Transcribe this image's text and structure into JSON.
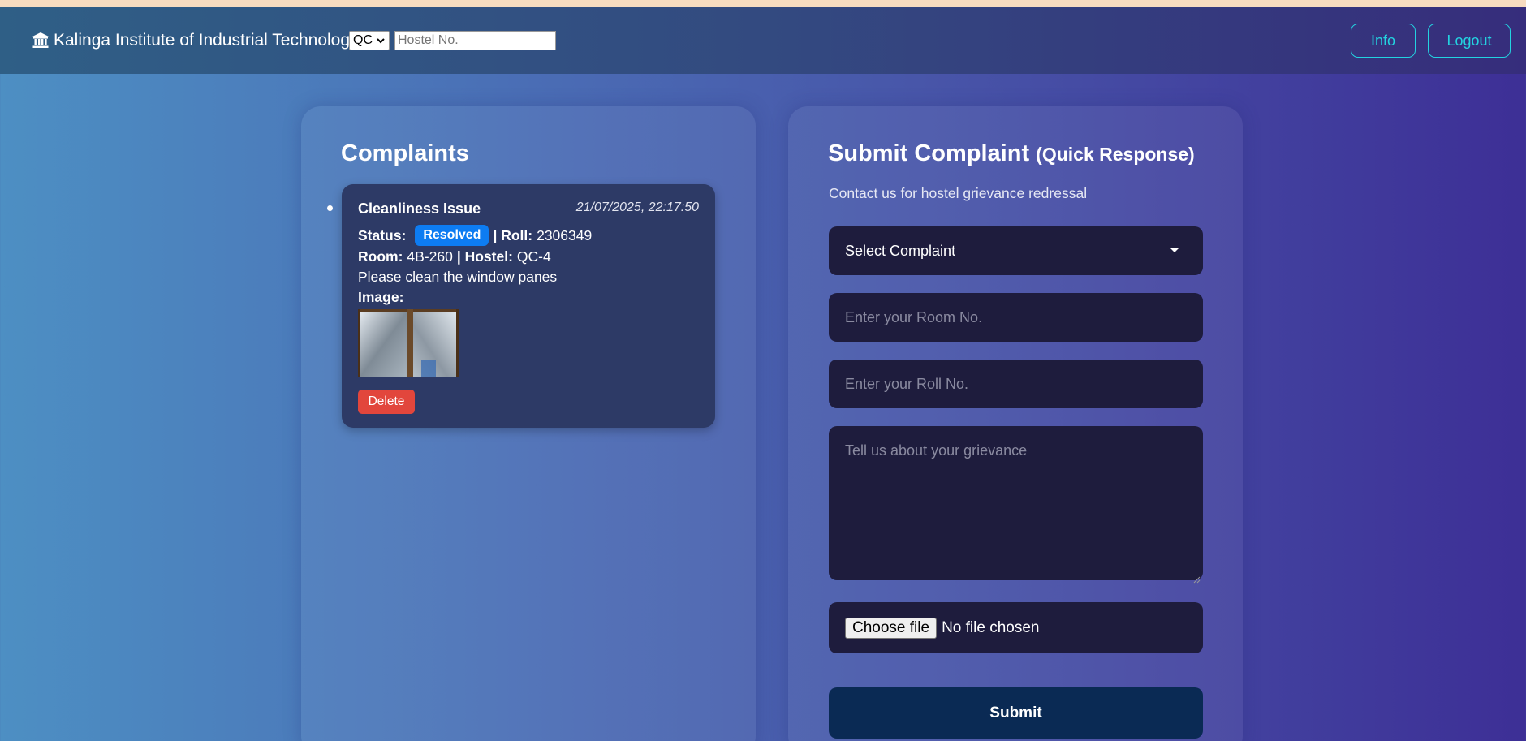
{
  "header": {
    "icon": "bank-icon",
    "brand": "Kalinga Institute of Industrial Technology",
    "hostel_select_value": "QC",
    "hostel_input_placeholder": "Hostel No.",
    "info_label": "Info",
    "logout_label": "Logout"
  },
  "complaints": {
    "title": "Complaints",
    "items": [
      {
        "title": "Cleanliness Issue",
        "date": "21/07/2025, 22:17:50",
        "status_label": "Status:",
        "status": "Resolved",
        "roll_label": "| Roll:",
        "roll": "2306349",
        "room_label": "Room:",
        "room": "4B-260",
        "hostel_label": "| Hostel:",
        "hostel": "QC-4",
        "description": "Please clean the window panes",
        "image_label": "Image:",
        "delete_label": "Delete"
      }
    ]
  },
  "form": {
    "title": "Submit Complaint",
    "title_suffix": "(Quick Response)",
    "subtitle": "Contact us for hostel grievance redressal",
    "select_value": "Select Complaint",
    "room_placeholder": "Enter your Room No.",
    "roll_placeholder": "Enter your Roll No.",
    "grievance_placeholder": "Tell us about your grievance",
    "choose_file_label": "Choose file",
    "no_file_label": "No file chosen",
    "submit_label": "Submit"
  },
  "colors": {
    "accent_cyan": "#23d3e0",
    "status_resolved": "#0d7cf2",
    "delete_red": "#e2463c",
    "submit_navy": "#0a2a54"
  }
}
